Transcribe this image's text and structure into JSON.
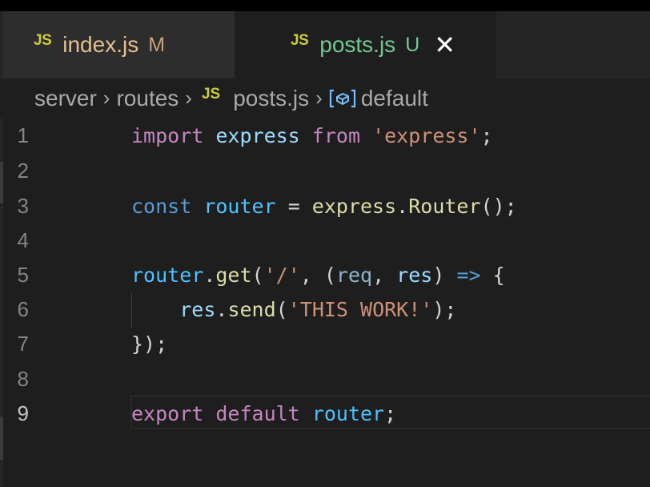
{
  "tabs": [
    {
      "icon": "JS",
      "name": "index.js",
      "badge": "M",
      "active": false
    },
    {
      "icon": "JS",
      "name": "posts.js",
      "badge": "U",
      "active": true,
      "close": "✕"
    }
  ],
  "breadcrumb": {
    "items": [
      "server",
      "routes",
      "posts.js",
      "default"
    ],
    "separator": "›",
    "file_icon": "JS",
    "symbol_icon": "[⊘]"
  },
  "editor": {
    "current_line": 9,
    "lines": [
      {
        "number": "1",
        "tokens": [
          [
            "kw",
            "import"
          ],
          [
            "punc",
            " "
          ],
          [
            "var",
            "express"
          ],
          [
            "punc",
            " "
          ],
          [
            "kw",
            "from"
          ],
          [
            "punc",
            " "
          ],
          [
            "str",
            "'express'"
          ],
          [
            "punc",
            ";"
          ]
        ]
      },
      {
        "number": "2",
        "tokens": []
      },
      {
        "number": "3",
        "tokens": [
          [
            "kw2",
            "const"
          ],
          [
            "punc",
            " "
          ],
          [
            "var2",
            "router"
          ],
          [
            "punc",
            " = "
          ],
          [
            "fn",
            "express"
          ],
          [
            "punc",
            "."
          ],
          [
            "fn",
            "Router"
          ],
          [
            "punc",
            "();"
          ]
        ]
      },
      {
        "number": "4",
        "tokens": []
      },
      {
        "number": "5",
        "tokens": [
          [
            "var2",
            "router"
          ],
          [
            "punc",
            "."
          ],
          [
            "fn",
            "get"
          ],
          [
            "punc",
            "("
          ],
          [
            "str",
            "'/'"
          ],
          [
            "punc",
            ", ("
          ],
          [
            "param",
            "req"
          ],
          [
            "punc",
            ", "
          ],
          [
            "var",
            "res"
          ],
          [
            "punc",
            ") "
          ],
          [
            "kw2",
            "=>"
          ],
          [
            "punc",
            " {"
          ]
        ]
      },
      {
        "number": "6",
        "tokens": [
          [
            "punc",
            "    "
          ],
          [
            "var",
            "res"
          ],
          [
            "punc",
            "."
          ],
          [
            "fn",
            "send"
          ],
          [
            "punc",
            "("
          ],
          [
            "str",
            "'THIS WORK!'"
          ],
          [
            "punc",
            ");"
          ]
        ]
      },
      {
        "number": "7",
        "tokens": [
          [
            "punc",
            "});"
          ]
        ]
      },
      {
        "number": "8",
        "tokens": []
      },
      {
        "number": "9",
        "tokens": [
          [
            "kw",
            "export"
          ],
          [
            "punc",
            " "
          ],
          [
            "kw",
            "default"
          ],
          [
            "punc",
            " "
          ],
          [
            "var2",
            "router"
          ],
          [
            "punc",
            ";"
          ]
        ]
      }
    ]
  }
}
